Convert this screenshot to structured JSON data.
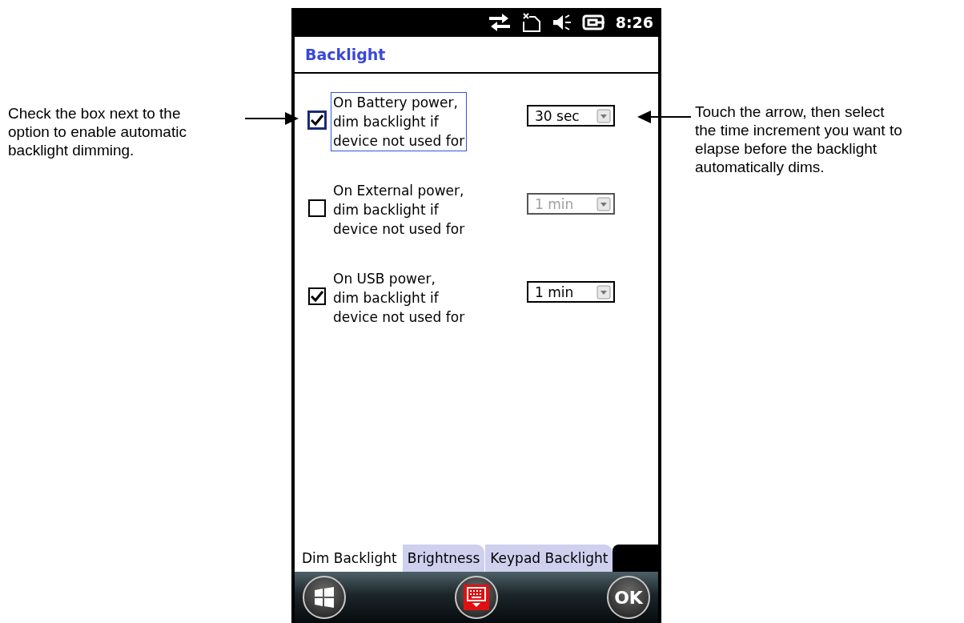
{
  "callouts": {
    "left": "Check the box next to the\noption to enable automatic\nbacklight dimming.",
    "right": "Touch the arrow, then select\nthe time increment you want to\nelapse before the backlight\nautomatically dims."
  },
  "status_bar": {
    "time": "8:26"
  },
  "title": "Backlight",
  "options": [
    {
      "label": "On Battery power,\ndim backlight if\ndevice not used for",
      "checked": true,
      "focused": true,
      "value": "30 sec",
      "disabled": false
    },
    {
      "label": "On External power,\ndim backlight if\ndevice not used for",
      "checked": false,
      "focused": false,
      "value": "1 min",
      "disabled": true
    },
    {
      "label": "On USB power,\ndim backlight if\ndevice not used for",
      "checked": true,
      "focused": false,
      "value": "1 min",
      "disabled": false
    }
  ],
  "tabs": [
    {
      "label": "Dim Backlight",
      "selected": true
    },
    {
      "label": "Brightness",
      "selected": false
    },
    {
      "label": "Keypad Backlight",
      "selected": false
    }
  ],
  "softkeys": {
    "ok": "OK"
  }
}
